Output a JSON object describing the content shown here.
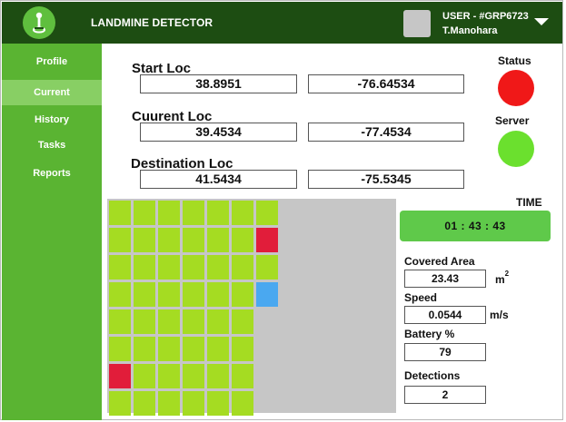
{
  "header": {
    "app_title": "LANDMINE DETECTOR",
    "user_id": "USER - #GRP6723",
    "user_name": "T.Manohara",
    "logo_icon": "landmine-detector-icon",
    "menu_icon": "chevron-down-icon"
  },
  "sidebar": {
    "items": [
      {
        "label": "Profile",
        "active": false
      },
      {
        "label": "Current",
        "active": true
      },
      {
        "label": "History",
        "active": false
      },
      {
        "label": "Tasks",
        "active": false
      },
      {
        "label": "Reports",
        "active": false
      }
    ]
  },
  "locations": {
    "start": {
      "label": "Start Loc",
      "lat": "38.8951",
      "lon": "-76.64534"
    },
    "current": {
      "label": "Cuurent Loc",
      "lat": "39.4534",
      "lon": "-77.4534"
    },
    "destination": {
      "label": "Destination Loc",
      "lat": "41.5434",
      "lon": "-75.5345"
    }
  },
  "status": {
    "status_label": "Status",
    "status_color": "#f01818",
    "server_label": "Server",
    "server_color": "#6be02e"
  },
  "time": {
    "label": "TIME",
    "value": "01 : 43 : 43"
  },
  "stats": {
    "covered_area": {
      "label": "Covered Area",
      "value": "23.43",
      "unit": "m",
      "unit_sup": "2"
    },
    "speed": {
      "label": "Speed",
      "value": "0.0544",
      "unit": "m/s"
    },
    "battery": {
      "label": "Battery %",
      "value": "79"
    },
    "detections": {
      "label": "Detections",
      "value": "2"
    }
  },
  "grid": {
    "columns": 7,
    "rows": 8,
    "colors": {
      "covered": "#a5dc22",
      "mine": "#e11d3a",
      "robot": "#4aa8f0",
      "uncovered": "#c6c6c6"
    },
    "cells": [
      [
        "covered",
        "covered",
        "covered",
        "covered",
        "covered",
        "covered",
        "covered"
      ],
      [
        "covered",
        "covered",
        "covered",
        "covered",
        "covered",
        "covered",
        "mine"
      ],
      [
        "covered",
        "covered",
        "covered",
        "covered",
        "covered",
        "covered",
        "covered"
      ],
      [
        "covered",
        "covered",
        "covered",
        "covered",
        "covered",
        "covered",
        "robot"
      ],
      [
        "covered",
        "covered",
        "covered",
        "covered",
        "covered",
        "covered",
        "uncovered"
      ],
      [
        "covered",
        "covered",
        "covered",
        "covered",
        "covered",
        "covered",
        "uncovered"
      ],
      [
        "mine",
        "covered",
        "covered",
        "covered",
        "covered",
        "covered",
        "uncovered"
      ],
      [
        "covered",
        "covered",
        "covered",
        "covered",
        "covered",
        "covered",
        "uncovered"
      ]
    ]
  }
}
